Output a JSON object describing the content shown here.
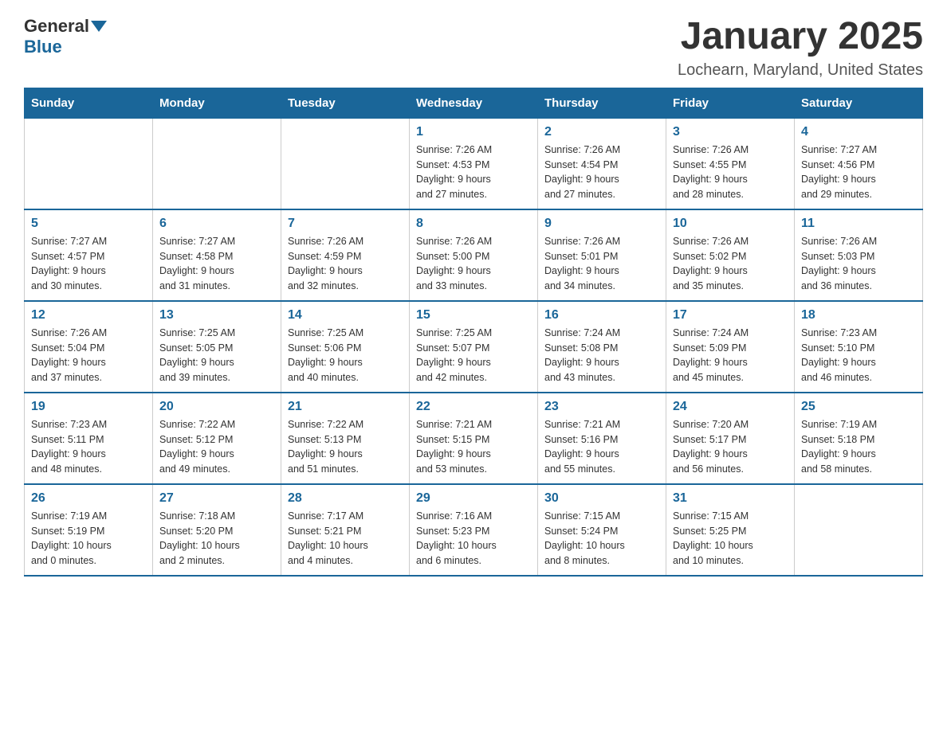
{
  "logo": {
    "general": "General",
    "blue": "Blue"
  },
  "title": "January 2025",
  "subtitle": "Lochearn, Maryland, United States",
  "days_of_week": [
    "Sunday",
    "Monday",
    "Tuesday",
    "Wednesday",
    "Thursday",
    "Friday",
    "Saturday"
  ],
  "weeks": [
    [
      {
        "day": "",
        "info": ""
      },
      {
        "day": "",
        "info": ""
      },
      {
        "day": "",
        "info": ""
      },
      {
        "day": "1",
        "info": "Sunrise: 7:26 AM\nSunset: 4:53 PM\nDaylight: 9 hours\nand 27 minutes."
      },
      {
        "day": "2",
        "info": "Sunrise: 7:26 AM\nSunset: 4:54 PM\nDaylight: 9 hours\nand 27 minutes."
      },
      {
        "day": "3",
        "info": "Sunrise: 7:26 AM\nSunset: 4:55 PM\nDaylight: 9 hours\nand 28 minutes."
      },
      {
        "day": "4",
        "info": "Sunrise: 7:27 AM\nSunset: 4:56 PM\nDaylight: 9 hours\nand 29 minutes."
      }
    ],
    [
      {
        "day": "5",
        "info": "Sunrise: 7:27 AM\nSunset: 4:57 PM\nDaylight: 9 hours\nand 30 minutes."
      },
      {
        "day": "6",
        "info": "Sunrise: 7:27 AM\nSunset: 4:58 PM\nDaylight: 9 hours\nand 31 minutes."
      },
      {
        "day": "7",
        "info": "Sunrise: 7:26 AM\nSunset: 4:59 PM\nDaylight: 9 hours\nand 32 minutes."
      },
      {
        "day": "8",
        "info": "Sunrise: 7:26 AM\nSunset: 5:00 PM\nDaylight: 9 hours\nand 33 minutes."
      },
      {
        "day": "9",
        "info": "Sunrise: 7:26 AM\nSunset: 5:01 PM\nDaylight: 9 hours\nand 34 minutes."
      },
      {
        "day": "10",
        "info": "Sunrise: 7:26 AM\nSunset: 5:02 PM\nDaylight: 9 hours\nand 35 minutes."
      },
      {
        "day": "11",
        "info": "Sunrise: 7:26 AM\nSunset: 5:03 PM\nDaylight: 9 hours\nand 36 minutes."
      }
    ],
    [
      {
        "day": "12",
        "info": "Sunrise: 7:26 AM\nSunset: 5:04 PM\nDaylight: 9 hours\nand 37 minutes."
      },
      {
        "day": "13",
        "info": "Sunrise: 7:25 AM\nSunset: 5:05 PM\nDaylight: 9 hours\nand 39 minutes."
      },
      {
        "day": "14",
        "info": "Sunrise: 7:25 AM\nSunset: 5:06 PM\nDaylight: 9 hours\nand 40 minutes."
      },
      {
        "day": "15",
        "info": "Sunrise: 7:25 AM\nSunset: 5:07 PM\nDaylight: 9 hours\nand 42 minutes."
      },
      {
        "day": "16",
        "info": "Sunrise: 7:24 AM\nSunset: 5:08 PM\nDaylight: 9 hours\nand 43 minutes."
      },
      {
        "day": "17",
        "info": "Sunrise: 7:24 AM\nSunset: 5:09 PM\nDaylight: 9 hours\nand 45 minutes."
      },
      {
        "day": "18",
        "info": "Sunrise: 7:23 AM\nSunset: 5:10 PM\nDaylight: 9 hours\nand 46 minutes."
      }
    ],
    [
      {
        "day": "19",
        "info": "Sunrise: 7:23 AM\nSunset: 5:11 PM\nDaylight: 9 hours\nand 48 minutes."
      },
      {
        "day": "20",
        "info": "Sunrise: 7:22 AM\nSunset: 5:12 PM\nDaylight: 9 hours\nand 49 minutes."
      },
      {
        "day": "21",
        "info": "Sunrise: 7:22 AM\nSunset: 5:13 PM\nDaylight: 9 hours\nand 51 minutes."
      },
      {
        "day": "22",
        "info": "Sunrise: 7:21 AM\nSunset: 5:15 PM\nDaylight: 9 hours\nand 53 minutes."
      },
      {
        "day": "23",
        "info": "Sunrise: 7:21 AM\nSunset: 5:16 PM\nDaylight: 9 hours\nand 55 minutes."
      },
      {
        "day": "24",
        "info": "Sunrise: 7:20 AM\nSunset: 5:17 PM\nDaylight: 9 hours\nand 56 minutes."
      },
      {
        "day": "25",
        "info": "Sunrise: 7:19 AM\nSunset: 5:18 PM\nDaylight: 9 hours\nand 58 minutes."
      }
    ],
    [
      {
        "day": "26",
        "info": "Sunrise: 7:19 AM\nSunset: 5:19 PM\nDaylight: 10 hours\nand 0 minutes."
      },
      {
        "day": "27",
        "info": "Sunrise: 7:18 AM\nSunset: 5:20 PM\nDaylight: 10 hours\nand 2 minutes."
      },
      {
        "day": "28",
        "info": "Sunrise: 7:17 AM\nSunset: 5:21 PM\nDaylight: 10 hours\nand 4 minutes."
      },
      {
        "day": "29",
        "info": "Sunrise: 7:16 AM\nSunset: 5:23 PM\nDaylight: 10 hours\nand 6 minutes."
      },
      {
        "day": "30",
        "info": "Sunrise: 7:15 AM\nSunset: 5:24 PM\nDaylight: 10 hours\nand 8 minutes."
      },
      {
        "day": "31",
        "info": "Sunrise: 7:15 AM\nSunset: 5:25 PM\nDaylight: 10 hours\nand 10 minutes."
      },
      {
        "day": "",
        "info": ""
      }
    ]
  ]
}
